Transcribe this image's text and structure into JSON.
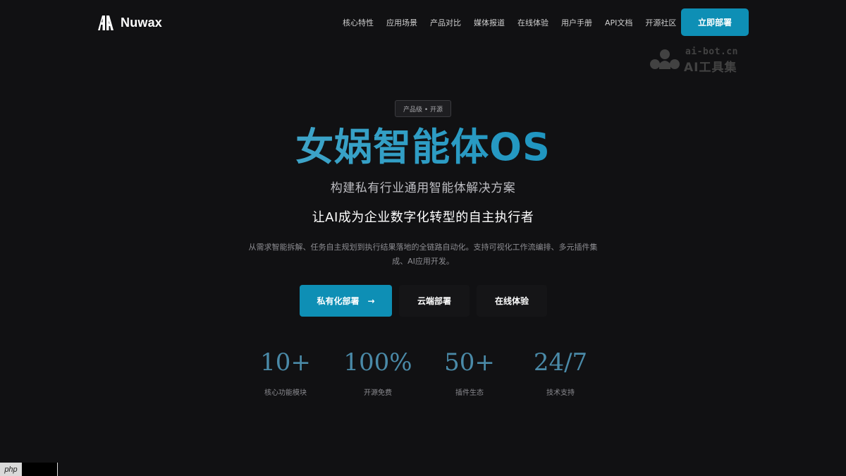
{
  "brand": {
    "name": "Nuwax"
  },
  "nav": {
    "links": [
      "核心特性",
      "应用场景",
      "产品对比",
      "媒体报道",
      "在线体验",
      "用户手册",
      "API文档",
      "开源社区"
    ],
    "deploy_label": "立即部署"
  },
  "watermark": {
    "domain": "ai-bot.cn",
    "name": "AI工具集"
  },
  "hero": {
    "badge": "产品级 • 开源",
    "title": "女娲智能体OS",
    "subtitle": "构建私有行业通用智能体解决方案",
    "slogan": "让AI成为企业数字化转型的自主执行者",
    "description": "从需求智能拆解、任务自主规划到执行结果落地的全链路自动化。支持可视化工作流编排、多元插件集成、AI应用开发。",
    "primary_button": "私有化部署",
    "primary_arrow": "→",
    "cloud_button": "云端部署",
    "online_button": "在线体验"
  },
  "stats": [
    {
      "value": "10+",
      "label": "核心功能模块"
    },
    {
      "value": "100%",
      "label": "开源免费"
    },
    {
      "value": "50+",
      "label": "插件生态"
    },
    {
      "value": "24/7",
      "label": "技术支持"
    }
  ],
  "corner": {
    "php": "php"
  },
  "colors": {
    "background": "#111113",
    "accent": "#0e8fb5",
    "stat_value": "#4a8aa8"
  }
}
